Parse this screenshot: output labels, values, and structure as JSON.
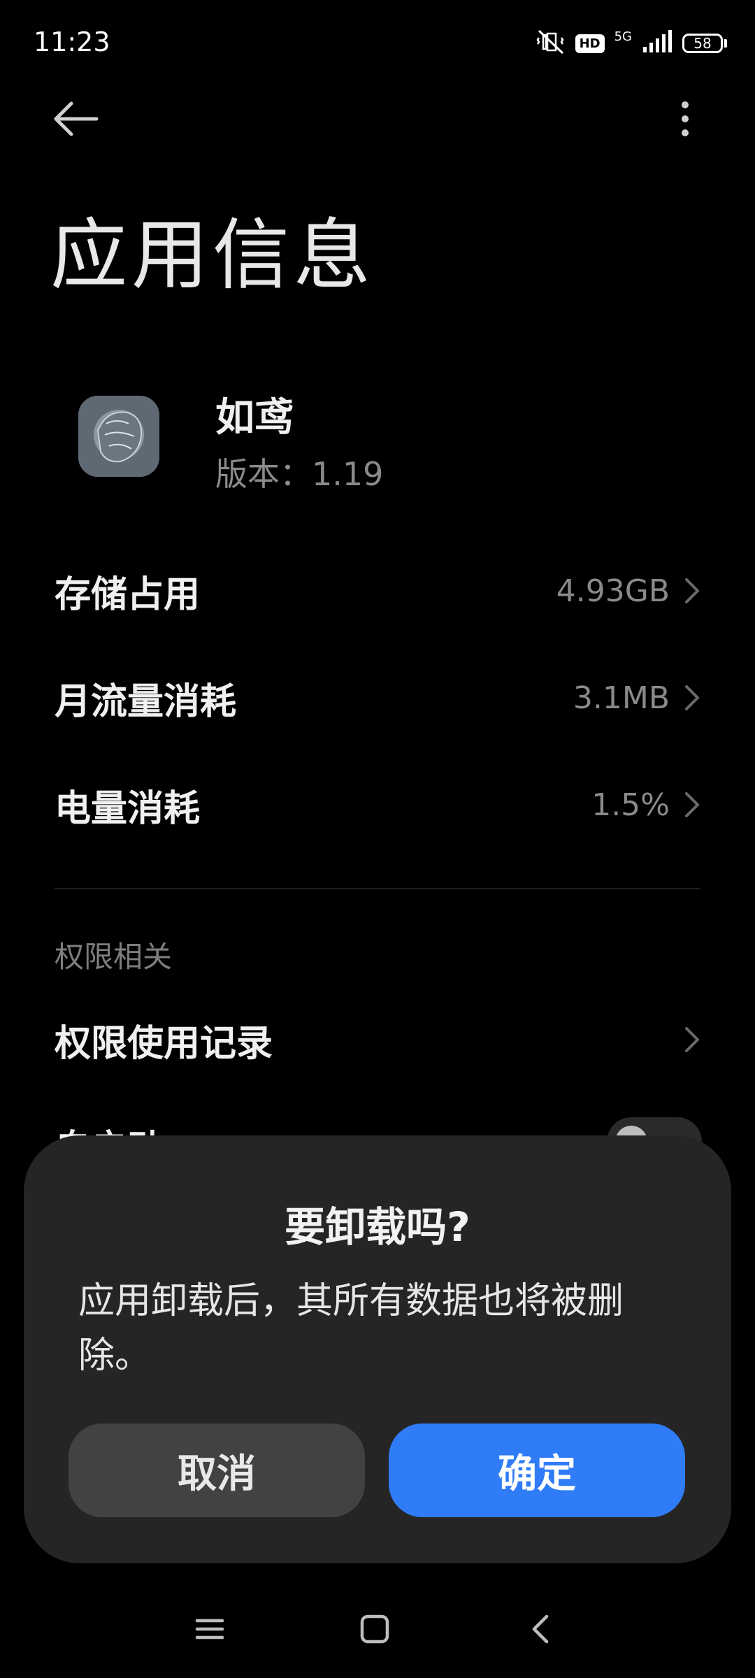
{
  "status_bar": {
    "time": "11:23",
    "network_label": "5G",
    "hd_label": "HD",
    "battery_level": "58"
  },
  "page": {
    "title": "应用信息"
  },
  "app": {
    "name": "如鸢",
    "version_label": "版本：",
    "version": "1.19"
  },
  "rows": [
    {
      "label": "存储占用",
      "value": "4.93GB"
    },
    {
      "label": "月流量消耗",
      "value": "3.1MB"
    },
    {
      "label": "电量消耗",
      "value": "1.5%"
    }
  ],
  "permissions": {
    "section_header": "权限相关",
    "usage_record_label": "权限使用记录",
    "partial_row_label": "自启动"
  },
  "dialog": {
    "title": "要卸载吗?",
    "message": "应用卸载后，其所有数据也将被删除。",
    "cancel_label": "取消",
    "confirm_label": "确定"
  },
  "colors": {
    "accent": "#2f7cf6",
    "dialog_bg": "#252525",
    "background": "#000000"
  },
  "icons": {
    "back": "arrow-left-icon",
    "more": "more-vertical-icon",
    "chevron": "chevron-right-icon",
    "nav_menu": "menu-icon",
    "nav_home": "home-square-icon",
    "nav_back": "back-chevron-icon"
  }
}
